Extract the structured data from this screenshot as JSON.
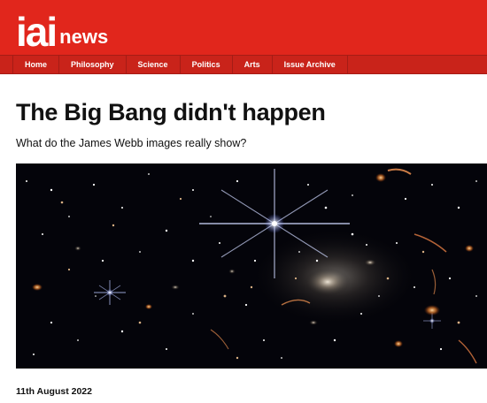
{
  "brand": {
    "mark": "iai",
    "word": "news"
  },
  "nav": {
    "items": [
      {
        "label": "Home"
      },
      {
        "label": "Philosophy"
      },
      {
        "label": "Science"
      },
      {
        "label": "Politics"
      },
      {
        "label": "Arts"
      },
      {
        "label": "Issue Archive"
      }
    ]
  },
  "article": {
    "title": "The Big Bang didn't happen",
    "subtitle": "What do the James Webb images really show?",
    "date": "11th August 2022"
  },
  "colors": {
    "brand_red": "#e1261c",
    "nav_red": "#c9231a",
    "image_bg": "#04040a"
  }
}
